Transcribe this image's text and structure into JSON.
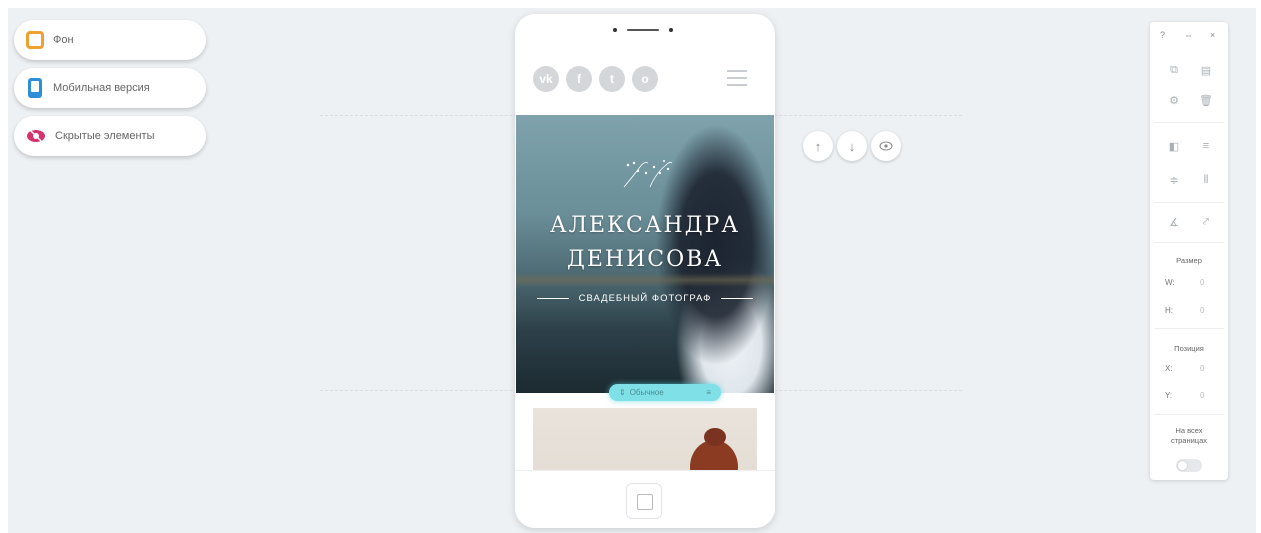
{
  "left_menu": {
    "background_label": "Фон",
    "mobile_label": "Мобильная версия",
    "hidden_label": "Скрытые элементы"
  },
  "phone": {
    "social": [
      "vk",
      "f",
      "t",
      "o"
    ],
    "hero_title_line1": "АЛЕКСАНДРА",
    "hero_title_line2": "ДЕНИСОВА",
    "hero_subtitle": "СВАДЕБНЫЙ ФОТОГРАФ",
    "block_pill_label": "Обычное"
  },
  "block_controls": {
    "up": "↑",
    "down": "↓",
    "eye": "◉"
  },
  "panel": {
    "help": "?",
    "expand": "⇔",
    "close": "×",
    "size_title": "Размер",
    "w_label": "W:",
    "w_value": "0",
    "h_label": "H:",
    "h_value": "0",
    "position_title": "Позиция",
    "x_label": "X:",
    "x_value": "0",
    "y_label": "Y:",
    "y_value": "0",
    "all_pages_line1": "На всех",
    "all_pages_line2": "страницах"
  },
  "colors": {
    "accent_orange": "#f0a030",
    "accent_blue": "#2d8fd8",
    "accent_pink": "#d6336c",
    "pill_cyan": "#7fe0e8"
  }
}
